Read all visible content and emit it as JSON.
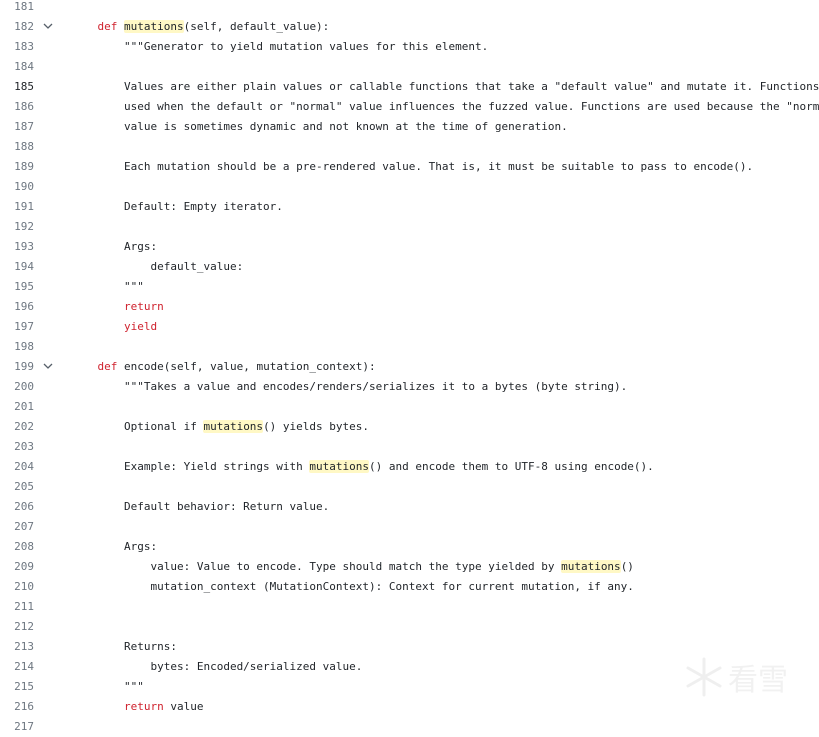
{
  "editor": {
    "colors": {
      "keyword": "#cf222e",
      "highlight": "#fff8c5",
      "line_number": "#6e7781",
      "text": "#1f2328"
    },
    "active_line": "185",
    "lines": [
      {
        "n": "181",
        "seg": []
      },
      {
        "n": "182",
        "fold": true,
        "seg": [
          [
            "    ",
            ""
          ],
          [
            "def",
            "kw"
          ],
          [
            " ",
            ""
          ],
          [
            "mutations",
            "hl"
          ],
          [
            "(self, default_value):",
            ""
          ]
        ]
      },
      {
        "n": "183",
        "seg": [
          [
            "        \"\"\"Generator to yield mutation values for this element.",
            ""
          ]
        ]
      },
      {
        "n": "184",
        "seg": []
      },
      {
        "n": "185",
        "seg": [
          [
            "        Values are either plain values or callable functions that take a \"default value\" and mutate it. Functions",
            ""
          ]
        ]
      },
      {
        "n": "186",
        "seg": [
          [
            "        used when the default or \"normal\" value influences the fuzzed value. Functions are used because the \"norma",
            ""
          ]
        ]
      },
      {
        "n": "187",
        "seg": [
          [
            "        value is sometimes dynamic and not known at the time of generation.",
            ""
          ]
        ]
      },
      {
        "n": "188",
        "seg": []
      },
      {
        "n": "189",
        "seg": [
          [
            "        Each mutation should be a pre-rendered value. That is, it must be suitable to pass to encode().",
            ""
          ]
        ]
      },
      {
        "n": "190",
        "seg": []
      },
      {
        "n": "191",
        "seg": [
          [
            "        Default: Empty iterator.",
            ""
          ]
        ]
      },
      {
        "n": "192",
        "seg": []
      },
      {
        "n": "193",
        "seg": [
          [
            "        Args:",
            ""
          ]
        ]
      },
      {
        "n": "194",
        "seg": [
          [
            "            default_value:",
            ""
          ]
        ]
      },
      {
        "n": "195",
        "seg": [
          [
            "        \"\"\"",
            ""
          ]
        ]
      },
      {
        "n": "196",
        "seg": [
          [
            "        ",
            ""
          ],
          [
            "return",
            "kw"
          ]
        ]
      },
      {
        "n": "197",
        "seg": [
          [
            "        ",
            ""
          ],
          [
            "yield",
            "kw"
          ]
        ]
      },
      {
        "n": "198",
        "seg": []
      },
      {
        "n": "199",
        "fold": true,
        "seg": [
          [
            "    ",
            ""
          ],
          [
            "def",
            "kw"
          ],
          [
            " encode(self, value, mutation_context):",
            ""
          ]
        ]
      },
      {
        "n": "200",
        "seg": [
          [
            "        \"\"\"Takes a value and encodes/renders/serializes it to a bytes (byte string).",
            ""
          ]
        ]
      },
      {
        "n": "201",
        "seg": []
      },
      {
        "n": "202",
        "seg": [
          [
            "        Optional if ",
            ""
          ],
          [
            "mutations",
            "hl"
          ],
          [
            "() yields bytes.",
            ""
          ]
        ]
      },
      {
        "n": "203",
        "seg": []
      },
      {
        "n": "204",
        "seg": [
          [
            "        Example: Yield strings with ",
            ""
          ],
          [
            "mutations",
            "hl"
          ],
          [
            "() and encode them to UTF-8 using encode().",
            ""
          ]
        ]
      },
      {
        "n": "205",
        "seg": []
      },
      {
        "n": "206",
        "seg": [
          [
            "        Default behavior: Return value.",
            ""
          ]
        ]
      },
      {
        "n": "207",
        "seg": []
      },
      {
        "n": "208",
        "seg": [
          [
            "        Args:",
            ""
          ]
        ]
      },
      {
        "n": "209",
        "seg": [
          [
            "            value: Value to encode. Type should match the type yielded by ",
            ""
          ],
          [
            "mutations",
            "hl"
          ],
          [
            "()",
            ""
          ]
        ]
      },
      {
        "n": "210",
        "seg": [
          [
            "            mutation_context (MutationContext): Context for current mutation, if any.",
            ""
          ]
        ]
      },
      {
        "n": "211",
        "seg": []
      },
      {
        "n": "212",
        "seg": []
      },
      {
        "n": "213",
        "seg": [
          [
            "        Returns:",
            ""
          ]
        ]
      },
      {
        "n": "214",
        "seg": [
          [
            "            bytes: Encoded/serialized value.",
            ""
          ]
        ]
      },
      {
        "n": "215",
        "seg": [
          [
            "        \"\"\"",
            ""
          ]
        ]
      },
      {
        "n": "216",
        "seg": [
          [
            "        ",
            ""
          ],
          [
            "return",
            "kw"
          ],
          [
            " value",
            ""
          ]
        ]
      },
      {
        "n": "217",
        "seg": []
      }
    ]
  },
  "watermark": {
    "text": "看雪",
    "icon": "snowflake-icon"
  }
}
